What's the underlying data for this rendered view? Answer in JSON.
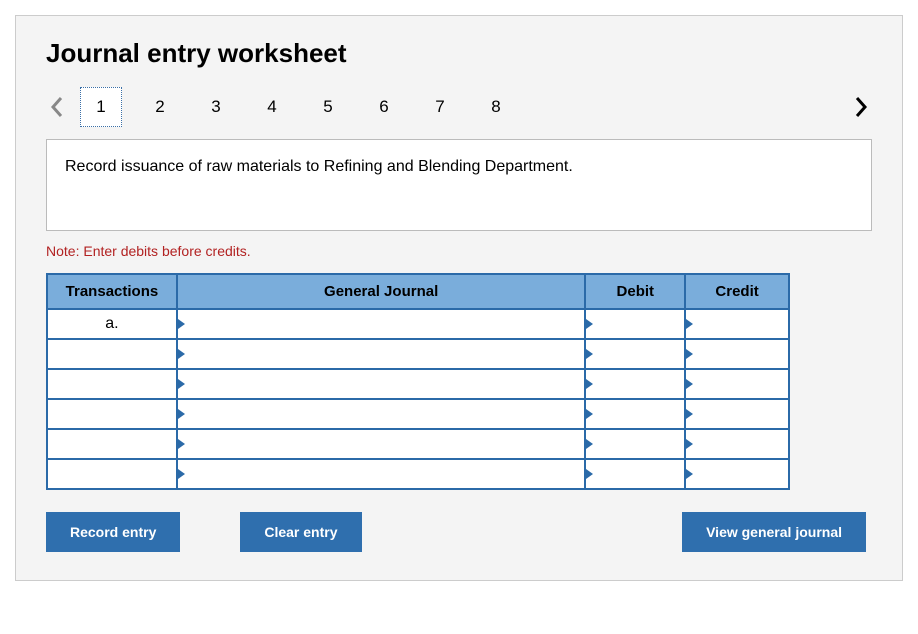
{
  "title": "Journal entry worksheet",
  "pager": {
    "pages": [
      "1",
      "2",
      "3",
      "4",
      "5",
      "6",
      "7",
      "8"
    ],
    "selected_index": 0
  },
  "prompt": "Record issuance of raw materials to Refining and Blending Department.",
  "note": "Note: Enter debits before credits.",
  "table": {
    "headers": {
      "transactions": "Transactions",
      "general_journal": "General Journal",
      "debit": "Debit",
      "credit": "Credit"
    },
    "rows": [
      {
        "transaction": "a.",
        "general_journal": "",
        "debit": "",
        "credit": ""
      },
      {
        "transaction": "",
        "general_journal": "",
        "debit": "",
        "credit": ""
      },
      {
        "transaction": "",
        "general_journal": "",
        "debit": "",
        "credit": ""
      },
      {
        "transaction": "",
        "general_journal": "",
        "debit": "",
        "credit": ""
      },
      {
        "transaction": "",
        "general_journal": "",
        "debit": "",
        "credit": ""
      },
      {
        "transaction": "",
        "general_journal": "",
        "debit": "",
        "credit": ""
      }
    ]
  },
  "buttons": {
    "record": "Record entry",
    "clear": "Clear entry",
    "view": "View general journal"
  }
}
